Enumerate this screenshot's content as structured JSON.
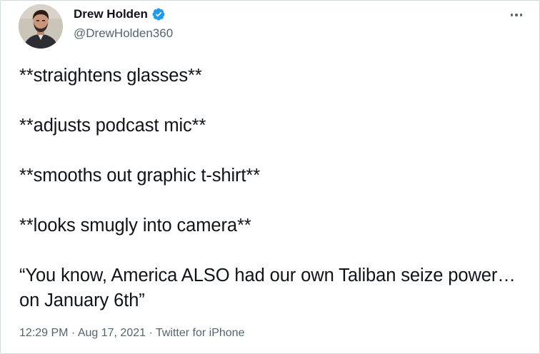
{
  "author": {
    "display_name": "Drew Holden",
    "handle": "@DrewHolden360",
    "verified": true,
    "avatar_icon": "profile-photo"
  },
  "tweet": {
    "lines": [
      "**straightens glasses**",
      "**adjusts podcast mic**",
      "**smooths out graphic t-shirt**",
      "**looks smugly into camera**",
      "“You know, America ALSO had our own Taliban seize power…on January 6th”"
    ]
  },
  "meta": {
    "time": "12:29 PM",
    "separator": " · ",
    "date": "Aug 17, 2021",
    "source": "Twitter for iPhone"
  },
  "colors": {
    "text": "#0f1419",
    "secondary": "#536471",
    "verified_blue": "#1d9bf0",
    "border": "#cfd9de"
  },
  "icons": {
    "more": "more-horizontal-icon",
    "verified": "verified-badge-icon"
  }
}
